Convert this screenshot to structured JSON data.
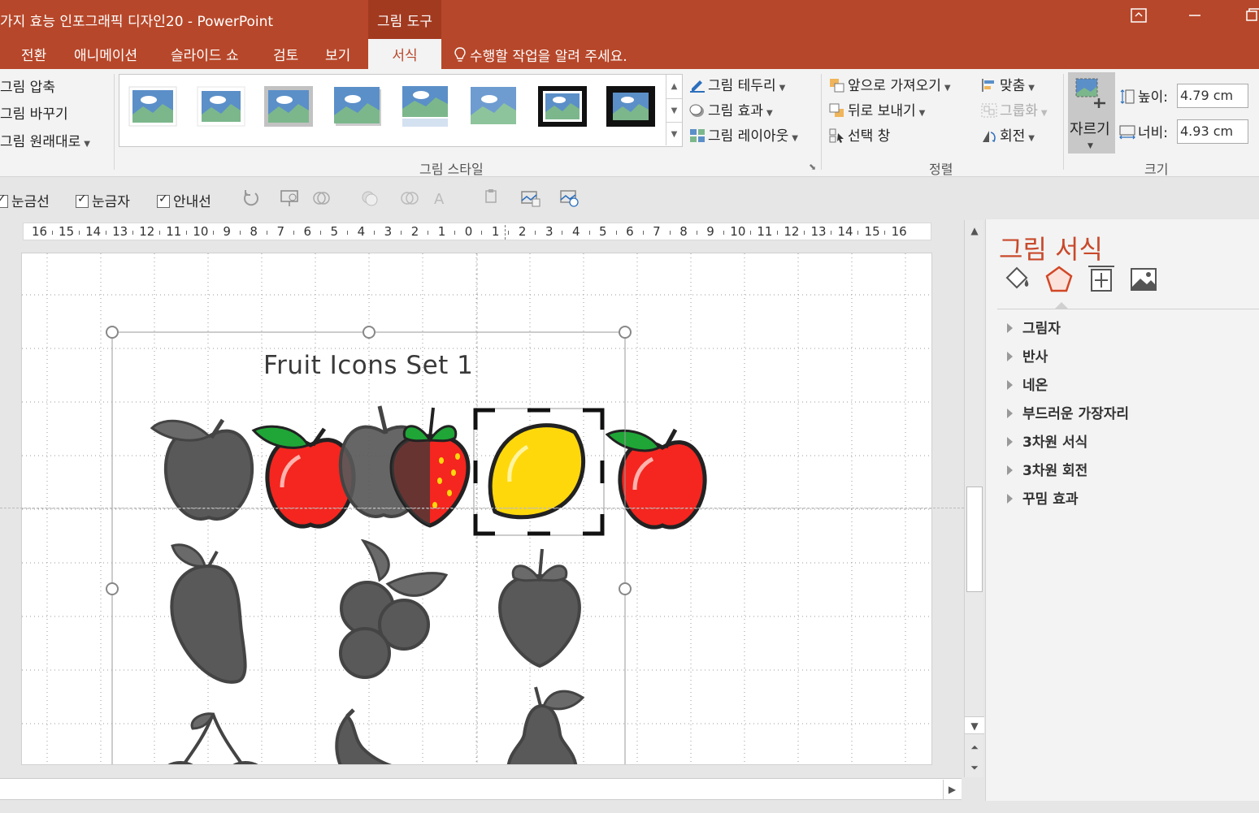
{
  "window": {
    "title": "가지 효능 인포그래픽 디자인20 - PowerPoint",
    "context_tab": "그림 도구"
  },
  "tabs": {
    "items": [
      "전환",
      "애니메이션",
      "슬라이드 쇼",
      "검토",
      "보기"
    ],
    "active": "서식",
    "tell_me": "수행할 작업을 알려 주세요."
  },
  "ribbon": {
    "adjust": {
      "compress": "그림 압축",
      "change": "그림 바꾸기",
      "reset": "그림 원래대로"
    },
    "styles": {
      "border": "그림 테두리",
      "effects": "그림 효과",
      "layout": "그림 레이아웃",
      "group_label": "그림 스타일"
    },
    "arrange": {
      "bring_forward": "앞으로 가져오기",
      "send_backward": "뒤로 보내기",
      "selection_pane": "선택 창",
      "align": "맞춤",
      "group": "그룹화",
      "rotate": "회전",
      "group_label": "정렬"
    },
    "size": {
      "crop": "자르기",
      "height_label": "높이:",
      "height_value": "4.79 cm",
      "width_label": "너비:",
      "width_value": "4.93 cm",
      "group_label": "크기"
    }
  },
  "view_toolbar": {
    "gridlines": "눈금선",
    "ruler": "눈금자",
    "guides": "안내선"
  },
  "ruler": {
    "labels": [
      "16",
      "15",
      "14",
      "13",
      "12",
      "11",
      "10",
      "9",
      "8",
      "7",
      "6",
      "5",
      "4",
      "3",
      "2",
      "1",
      "0",
      "1",
      "2",
      "3",
      "4",
      "5",
      "6",
      "7",
      "8",
      "9",
      "10",
      "11",
      "12",
      "13",
      "14",
      "15",
      "16"
    ]
  },
  "slide": {
    "title": "Fruit Icons Set  1"
  },
  "format_pane": {
    "title": "그림 서식",
    "icons": [
      "fill-line-icon",
      "effects-icon",
      "size-properties-icon",
      "picture-icon"
    ],
    "sections": [
      "그림자",
      "반사",
      "네온",
      "부드러운 가장자리",
      "3차원 서식",
      "3차원 회전",
      "꾸밈 효과"
    ]
  },
  "colors": {
    "accent": "#b7472a",
    "pane_title": "#c8492b",
    "apple_red": "#f4261f",
    "lemon": "#ffd80c",
    "leaf": "#1fa637",
    "gray_fruit": "#595959"
  }
}
